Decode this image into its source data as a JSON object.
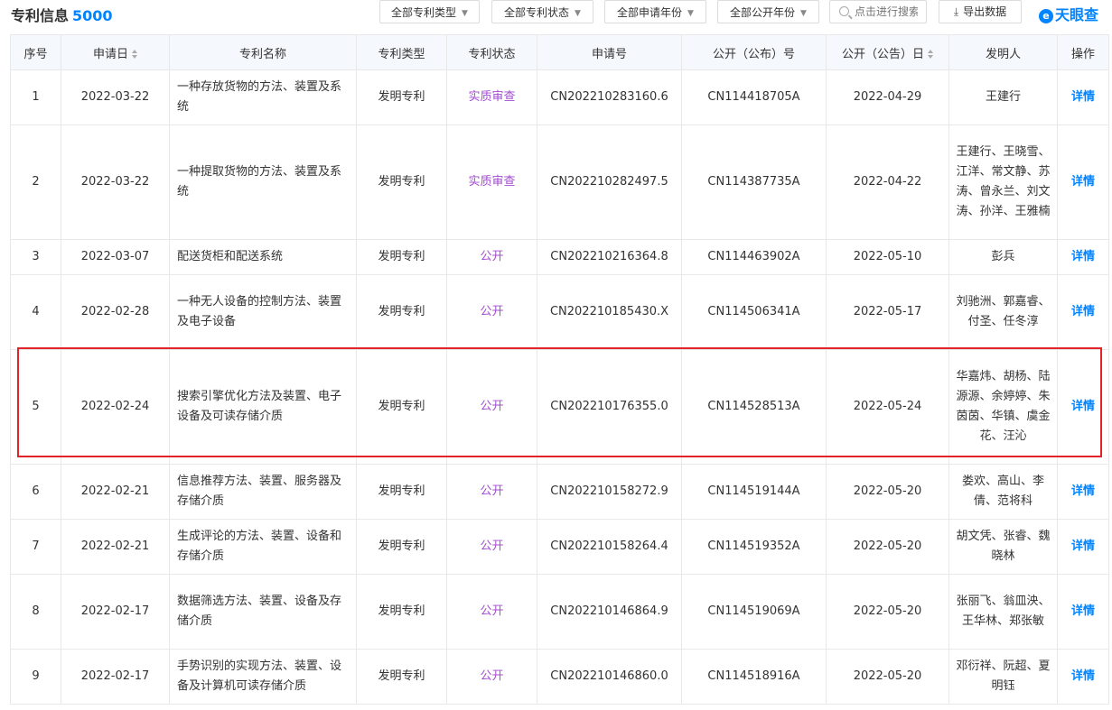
{
  "header": {
    "title": "专利信息",
    "count": "5000",
    "filters": [
      "全部专利类型",
      "全部专利状态",
      "全部申请年份",
      "全部公开年份"
    ],
    "search_placeholder": "点击进行搜索",
    "export_label": "导出数据",
    "logo_text": "天眼查",
    "logo_mark": "e"
  },
  "table": {
    "columns": [
      "序号",
      "申请日",
      "专利名称",
      "专利类型",
      "专利状态",
      "申请号",
      "公开（公布）号",
      "公开（公告）日",
      "发明人",
      "操作"
    ],
    "rows": [
      {
        "no": "1",
        "date": "2022-03-22",
        "name": "一种存放货物的方法、装置及系统",
        "type": "发明专利",
        "status": "实质审查",
        "app_no": "CN202210283160.6",
        "pub_no": "CN114418705A",
        "pub_date": "2022-04-29",
        "inventors": "王建行",
        "action": "详情"
      },
      {
        "no": "2",
        "date": "2022-03-22",
        "name": "一种提取货物的方法、装置及系统",
        "type": "发明专利",
        "status": "实质审查",
        "app_no": "CN202210282497.5",
        "pub_no": "CN114387735A",
        "pub_date": "2022-04-22",
        "inventors": "王建行、王晓雪、江洋、常文静、苏涛、曾永兰、刘文涛、孙洋、王雅楠",
        "action": "详情"
      },
      {
        "no": "3",
        "date": "2022-03-07",
        "name": "配送货柜和配送系统",
        "type": "发明专利",
        "status": "公开",
        "app_no": "CN202210216364.8",
        "pub_no": "CN114463902A",
        "pub_date": "2022-05-10",
        "inventors": "彭兵",
        "action": "详情"
      },
      {
        "no": "4",
        "date": "2022-02-28",
        "name": "一种无人设备的控制方法、装置及电子设备",
        "type": "发明专利",
        "status": "公开",
        "app_no": "CN202210185430.X",
        "pub_no": "CN114506341A",
        "pub_date": "2022-05-17",
        "inventors": "刘驰洲、郭嘉睿、付圣、任冬淳",
        "action": "详情"
      },
      {
        "no": "5",
        "date": "2022-02-24",
        "name": "搜索引擎优化方法及装置、电子设备及可读存储介质",
        "type": "发明专利",
        "status": "公开",
        "app_no": "CN202210176355.0",
        "pub_no": "CN114528513A",
        "pub_date": "2022-05-24",
        "inventors": "华嘉炜、胡杨、陆源源、余婷婷、朱茵茵、华镇、虞金花、汪沁",
        "action": "详情"
      },
      {
        "no": "6",
        "date": "2022-02-21",
        "name": "信息推荐方法、装置、服务器及存储介质",
        "type": "发明专利",
        "status": "公开",
        "app_no": "CN202210158272.9",
        "pub_no": "CN114519144A",
        "pub_date": "2022-05-20",
        "inventors": "娄欢、高山、李倩、范将科",
        "action": "详情"
      },
      {
        "no": "7",
        "date": "2022-02-21",
        "name": "生成评论的方法、装置、设备和存储介质",
        "type": "发明专利",
        "status": "公开",
        "app_no": "CN202210158264.4",
        "pub_no": "CN114519352A",
        "pub_date": "2022-05-20",
        "inventors": "胡文凭、张睿、魏晓林",
        "action": "详情"
      },
      {
        "no": "8",
        "date": "2022-02-17",
        "name": "数据筛选方法、装置、设备及存储介质",
        "type": "发明专利",
        "status": "公开",
        "app_no": "CN202210146864.9",
        "pub_no": "CN114519069A",
        "pub_date": "2022-05-20",
        "inventors": "张丽飞、翁皿泱、王华林、郑张敏",
        "action": "详情"
      },
      {
        "no": "9",
        "date": "2022-02-17",
        "name": "手势识别的实现方法、装置、设备及计算机可读存储介质",
        "type": "发明专利",
        "status": "公开",
        "app_no": "CN202210146860.0",
        "pub_no": "CN114518916A",
        "pub_date": "2022-05-20",
        "inventors": "邓衍祥、阮超、夏明钰",
        "action": "详情"
      }
    ]
  },
  "colors": {
    "accent": "#0084ff",
    "status": "#a14cce",
    "highlight": "#e0242a",
    "header_bg": "#f5f8fc"
  }
}
